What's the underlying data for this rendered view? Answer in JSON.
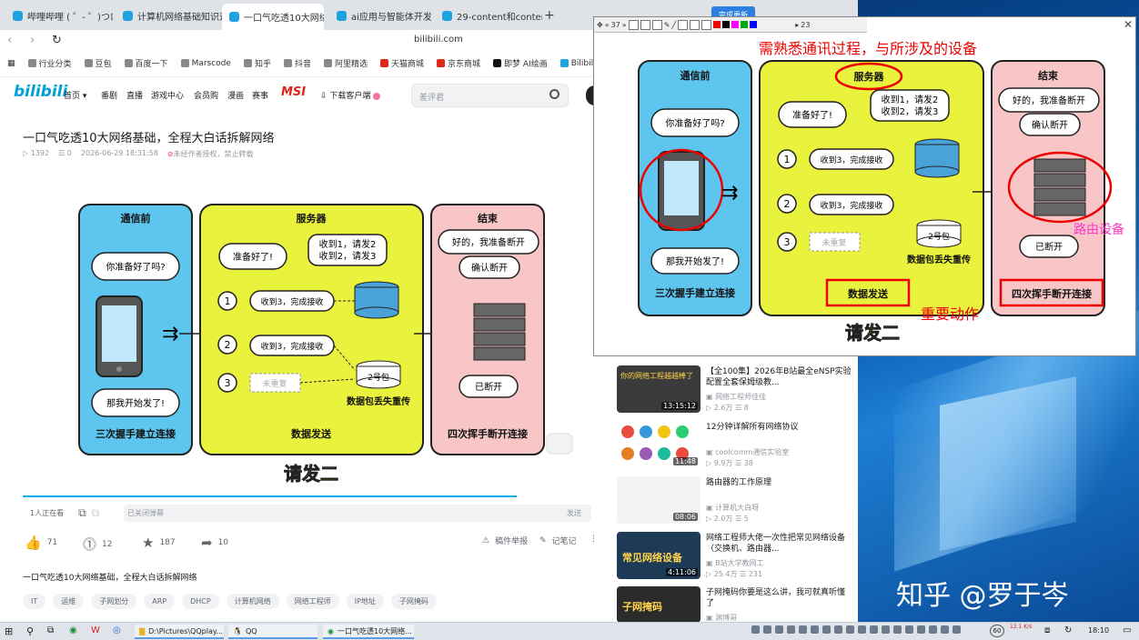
{
  "tabs": [
    {
      "label": "哔哩哔哩 ( ゜- ゜)つロ 干"
    },
    {
      "label": "计算机网络基础知识速成"
    },
    {
      "label": "一口气吃透10大网络"
    },
    {
      "label": "ai应用与智能体开发-哔"
    },
    {
      "label": "29-content和content_l"
    }
  ],
  "address": {
    "url": "bilibili.com"
  },
  "bookmarks": [
    "行业分类",
    "豆包",
    "百度一下",
    "Marscode",
    "知乎",
    "抖音",
    "阿里精选",
    "天猫商城",
    "京东商城",
    "即梦 AI绘画",
    "Bilibili",
    "今日"
  ],
  "header": {
    "logo": "bilibili",
    "nav": [
      "首页",
      "番剧",
      "直播",
      "游戏中心",
      "会员购",
      "漫画",
      "赛事"
    ],
    "msi": "MSI",
    "download": "下载客户端",
    "search_placeholder": "差评君"
  },
  "video": {
    "title": "一口气吃透10大网络基础，全程大白话拆解网络",
    "plays": "1392",
    "danmaku_count": "0",
    "date": "2026-06-29 18:31:58",
    "copyright": "未经作者授权，禁止转载"
  },
  "diagram": {
    "col1_title": "通信前",
    "col1_bubble1": "你准备好了吗?",
    "col1_bubble2": "那我开始发了!",
    "col1_caption": "三次握手建立连接",
    "col2_title": "服务器",
    "col2_bubble_ready": "准备好了!",
    "col2_bubble_recv1": "收到1，请发2",
    "col2_bubble_recv2": "收到2，请发3",
    "step1": "收到3，完成接收",
    "step2": "收到3，完成接收",
    "step3": "未重复",
    "packet": "2号包",
    "packet_lost": "数据包丢失重传",
    "col2_caption": "数据发送",
    "col3_title": "结束",
    "col3_bubble1": "好的，我准备断开",
    "col3_bubble2": "确认断开",
    "col3_bubble3": "已断开",
    "col3_caption": "四次挥手断开连接",
    "n1": "1",
    "n2": "2",
    "n3": "3",
    "subtitle": "请发二"
  },
  "player": {
    "viewers": "1人正在看",
    "danmaku_placeholder": "已关闭弹幕",
    "send": "发送"
  },
  "actions": {
    "like": "71",
    "coin": "12",
    "fav": "187",
    "share": "10",
    "report": "稿件举报",
    "note": "记笔记"
  },
  "desc": "一口气吃透10大网络基础，全程大白话拆解网络",
  "tags": [
    "IT",
    "运维",
    "子网划分",
    "ARP",
    "DHCP",
    "计算机网络",
    "网络工程师",
    "IP地址",
    "子网掩码"
  ],
  "recommend": [
    {
      "title": "【全100集】2026年B站最全eNSP实验配置全套保姆级教...",
      "up": "网络工程师佳佳",
      "plays": "2.6万",
      "comments": "8",
      "duration": "13:15:12",
      "thumb_text": "你的网络工程越越棒了"
    },
    {
      "title": "12分钟详解所有网络协议",
      "up": "coolcomm通信实验室",
      "plays": "9.9万",
      "comments": "38",
      "duration": "11:48",
      "thumb_text": ""
    },
    {
      "title": "路由器的工作原理",
      "up": "计算机大白呀",
      "plays": "2.0万",
      "comments": "5",
      "duration": "08:06",
      "thumb_text": ""
    },
    {
      "title": "网络工程师大佬一次性把常见网络设备（交换机、路由器...",
      "up": "B站大学教网工",
      "plays": "25.4万",
      "comments": "231",
      "duration": "4:11:06",
      "thumb_text": "常见网络设备"
    },
    {
      "title": "子网掩码你要是这么讲，我可就真听懂了",
      "up": "渊博哥",
      "plays": "",
      "comments": "",
      "duration": "",
      "thumb_text": "子网掩码"
    }
  ],
  "overlay": {
    "zoom": "37",
    "page": "23",
    "update": "完成更新",
    "note_top": "需熟悉通讯过程，与所涉及的设备",
    "note_router": "路由设备",
    "note_action": "重要动作"
  },
  "taskbar": {
    "tasks": [
      "D:\\Pictures\\QQplay...",
      "QQ",
      "一口气吃透10大网络..."
    ],
    "clock": "18:10",
    "net_up": "12.1 K/s",
    "battery": "60"
  },
  "watermark": "知乎 @罗于岑",
  "colors": {
    "bili_blue": "#00a1d6",
    "panel_blue": "#5ec5ee",
    "panel_yellow": "#e9f23c",
    "panel_pink": "#f8c6c6",
    "annotation_red": "#e00000",
    "router_magenta": "#ff33cc"
  }
}
